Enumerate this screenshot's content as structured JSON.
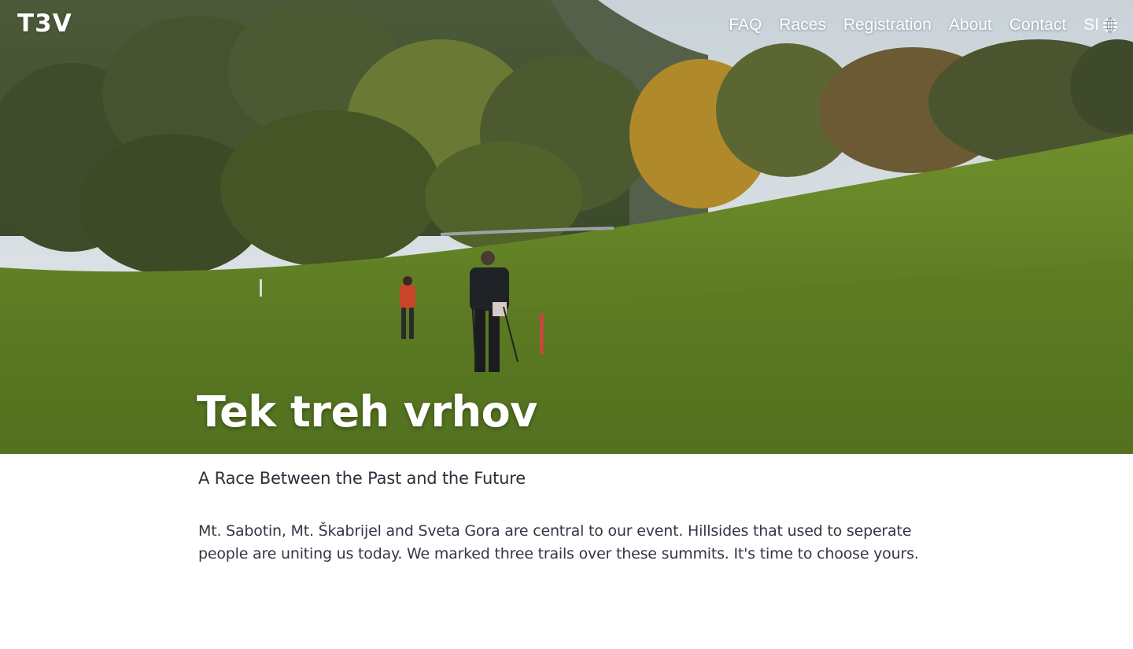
{
  "logo": {
    "text": "T3V"
  },
  "nav": {
    "items": [
      {
        "label": "FAQ"
      },
      {
        "label": "Races"
      },
      {
        "label": "Registration"
      },
      {
        "label": "About"
      },
      {
        "label": "Contact"
      }
    ],
    "language": {
      "label": "SI",
      "icon": "globe-icon"
    }
  },
  "hero": {
    "title": "Tek treh vrhov"
  },
  "main": {
    "subtitle": "A Race Between the Past and the Future",
    "intro": "Mt. Sabotin, Mt. Škabrijel and Sveta Gora are central to our event. Hillsides that used to seperate people are uniting us today. We marked three trails over these summits. It's time to choose yours."
  },
  "colors": {
    "text": "#2b2f3a",
    "nav_text": "#ffffff",
    "background": "#ffffff"
  }
}
